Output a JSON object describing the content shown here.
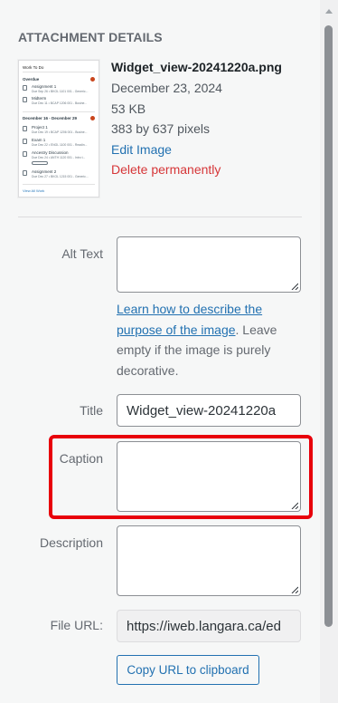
{
  "section_title": "ATTACHMENT DETAILS",
  "thumbnail": {
    "header": "Work To Do",
    "overdue_label": "Overdue",
    "items_overdue": [
      {
        "title": "Assignment 1",
        "sub": "Due Sep 26 • BKOL 1101 001 - Generic..."
      },
      {
        "title": "Midterm",
        "sub": "Due Dec 11 • BCAP 1206 001 - Busine..."
      }
    ],
    "range_label": "December 16 - December 29",
    "items_range": [
      {
        "title": "Project 1",
        "sub": "Due Dec 19 • BCAP 1206 001 - Busine..."
      },
      {
        "title": "Exam 1",
        "sub": "Due Dec 22 • ENGL 1100 001 - Readin..."
      },
      {
        "title": "Ancestry Discussion",
        "sub": "Due Dec 24 • ANTH 1120 001 - Intro t..."
      },
      {
        "title": "Assignment 2",
        "sub": "Due Dec 27 • BKOL 1215 001 - Generic..."
      }
    ],
    "pill": "Starts Dec 24",
    "view_all": "View All Work"
  },
  "file": {
    "name": "Widget_view-20241220a.png",
    "date": "December 23, 2024",
    "size": "53 KB",
    "dimensions": "383 by 637 pixels",
    "edit_label": "Edit Image",
    "delete_label": "Delete permanently"
  },
  "form": {
    "alt_text_label": "Alt Text",
    "alt_text_value": "",
    "help_link": "Learn how to describe the purpose of the image",
    "help_rest": ". Leave empty if the image is purely decorative.",
    "title_label": "Title",
    "title_value": "Widget_view-20241220a",
    "caption_label": "Caption",
    "caption_value": "",
    "description_label": "Description",
    "description_value": "",
    "file_url_label": "File URL:",
    "file_url_value": "https://iweb.langara.ca/ed",
    "copy_button": "Copy URL to clipboard"
  },
  "colors": {
    "highlight": "#e8000b",
    "link": "#2271b1",
    "danger": "#d63638"
  }
}
